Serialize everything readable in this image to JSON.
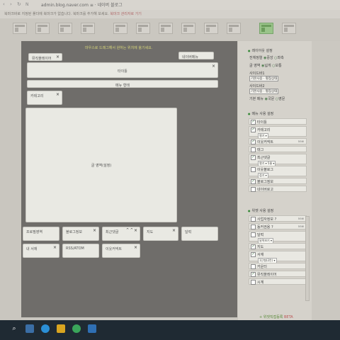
{
  "browser": {
    "url": "admin.blog.naver.com",
    "title": "네이버 블로그",
    "separator": "≡ ·"
  },
  "bookmark_bar": {
    "message": "북마크바로 지정된 폴더에 북마크가 없습니다. 북마크를 추가해 보세요.",
    "link": "북마크 관리자로 가기"
  },
  "canvas": {
    "hint": "마우스로 드래그해서 원하는 위치에 옮기세요.",
    "widgets": {
      "music_player": "뮤직플레이어",
      "naver_menu": "네이버메뉴",
      "title": "타이틀",
      "menu": "메뉴 형태",
      "category": "카테고리",
      "body": "글 영역(설정)",
      "profile": "프로필영역",
      "blog_info": "블로그정보",
      "recent_comments": "최근댓글",
      "map": "지도",
      "calendar": "달력",
      "my_library": "내 서재",
      "rss": "RSS/ATOM",
      "neighbor_widget": "이웃커넥트"
    }
  },
  "sidebar": {
    "layout_title": "레이아웃 설정",
    "align_label": "전체정렬",
    "align_options": [
      "중앙",
      "좌측"
    ],
    "post_area_label": "글 영역",
    "post_area_options": [
      "넓게",
      "보통"
    ],
    "sidebar1_label": "사이드바1",
    "sidebar1_value": "기본사용 · 펼침상태",
    "sidebar2_label": "사이드바2",
    "sidebar2_value": "기본사용 · 펼침상태",
    "basic_menu_label": "기본 메뉴",
    "basic_menu_options": [
      "국문",
      "영문"
    ],
    "menu_title": "메뉴 사용 설정",
    "menu_items": [
      {
        "label": "타이틀",
        "checked": true
      },
      {
        "label": "카테고리",
        "checked": true,
        "sub": "열기 ▾"
      },
      {
        "label": "이웃커넥트",
        "checked": true,
        "tail": "new"
      },
      {
        "label": "태그",
        "checked": false
      },
      {
        "label": "최근댓글",
        "checked": true,
        "sub": "열기 ▾  5줄 ▾"
      },
      {
        "label": "이웃블로그",
        "checked": false,
        "sub": "접기 ▾"
      },
      {
        "label": "블로그정보",
        "checked": true
      },
      {
        "label": "네이버로고",
        "checked": false
      }
    ],
    "widget_title": "위젯 사용 설정",
    "widget_items": [
      {
        "label": "사업자정보 ?",
        "checked": false,
        "tail": "new"
      },
      {
        "label": "동커권용 ?",
        "checked": false,
        "tail": "new"
      },
      {
        "label": "달력",
        "checked": false,
        "sub": "달력보기 ▾"
      },
      {
        "label": "지도",
        "checked": true
      },
      {
        "label": "서재",
        "checked": true,
        "sub": "1단형(2칸) ▾"
      },
      {
        "label": "카운터",
        "checked": false
      },
      {
        "label": "뮤직플레이어",
        "checked": true
      },
      {
        "label": "시계",
        "checked": false
      }
    ],
    "add_widget": "위젯직접등록",
    "add_widget_tag": "BETA"
  },
  "colors": {
    "accent_green": "#6d9d5d",
    "canvas_bg": "#6f6d6a",
    "taskbar": "#1f2a33"
  }
}
